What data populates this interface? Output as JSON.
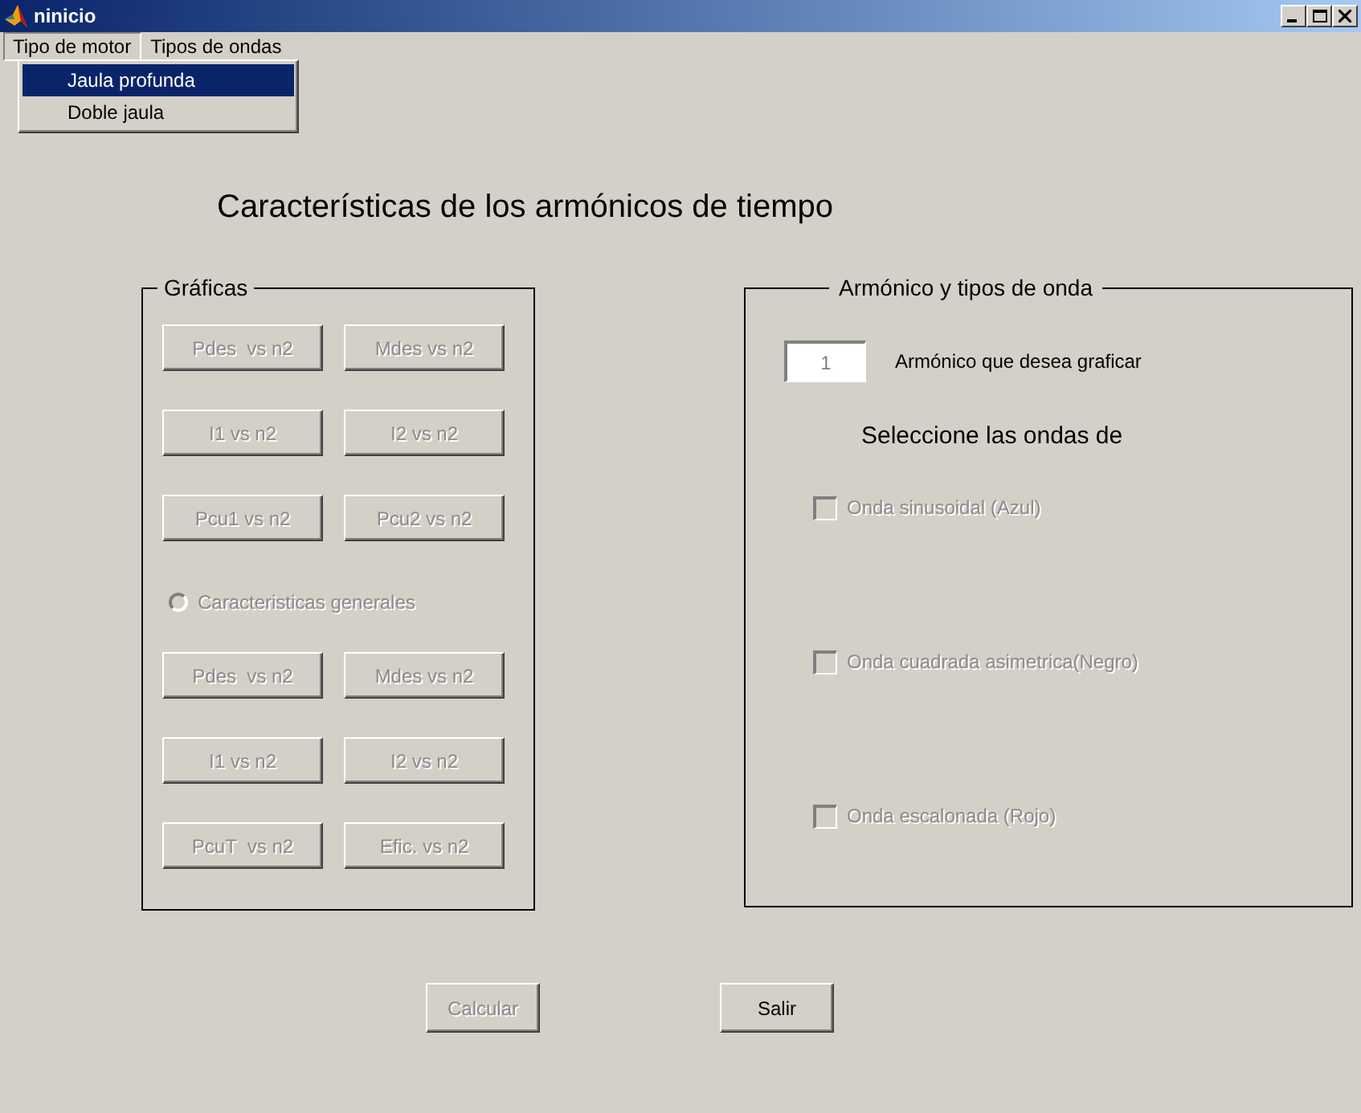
{
  "window": {
    "title": "ninicio"
  },
  "menus": [
    {
      "label": "Tipo de motor",
      "selected": true
    },
    {
      "label": "Tipos de ondas",
      "selected": false
    }
  ],
  "dropdown": [
    {
      "label": "Jaula profunda",
      "selected": true
    },
    {
      "label": "Doble jaula",
      "selected": false
    }
  ],
  "heading": "Características de los armónicos de tiempo",
  "graphs_panel": {
    "title": "Gráficas",
    "buttons_top": [
      {
        "label": "Pdes  vs n2",
        "disabled": true
      },
      {
        "label": "Mdes vs n2",
        "disabled": true
      },
      {
        "label": "I1 vs n2",
        "disabled": true
      },
      {
        "label": "I2 vs n2",
        "disabled": true
      },
      {
        "label": "Pcu1 vs n2",
        "disabled": true
      },
      {
        "label": "Pcu2 vs n2",
        "disabled": true
      }
    ],
    "radio": {
      "label": "Caracteristicas generales",
      "checked": false,
      "disabled": true
    },
    "buttons_bottom": [
      {
        "label": "Pdes  vs n2",
        "disabled": true
      },
      {
        "label": "Mdes vs n2",
        "disabled": true
      },
      {
        "label": "I1 vs n2",
        "disabled": true
      },
      {
        "label": "I2 vs n2",
        "disabled": true
      },
      {
        "label": "PcuT  vs n2",
        "disabled": true
      },
      {
        "label": "Efic. vs n2",
        "disabled": true
      }
    ]
  },
  "wave_panel": {
    "title": "Armónico y tipos de onda",
    "harmonic_field": {
      "value": "1",
      "label": "Armónico que desea graficar"
    },
    "subtitle": "Seleccione las ondas de",
    "checkboxes": [
      {
        "label": "Onda sinusoidal (Azul)",
        "checked": false,
        "disabled": true
      },
      {
        "label": "Onda cuadrada asimetrica(Negro)",
        "checked": false,
        "disabled": true
      },
      {
        "label": "Onda escalonada (Rojo)",
        "checked": false,
        "disabled": true
      }
    ]
  },
  "actions": [
    {
      "label": "Calcular",
      "disabled": true
    },
    {
      "label": "Salir",
      "disabled": false
    }
  ]
}
